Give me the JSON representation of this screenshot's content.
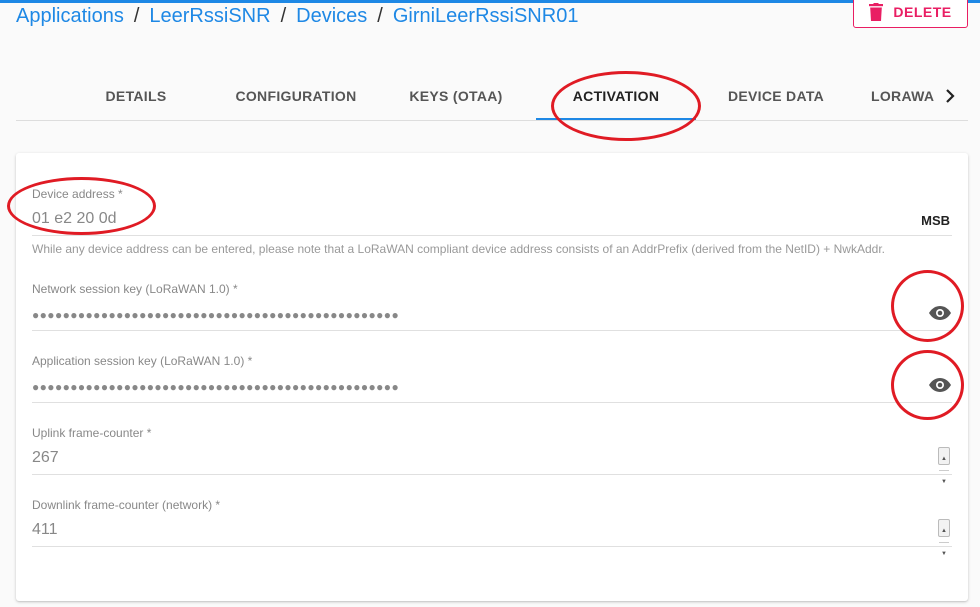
{
  "breadcrumb": [
    "Applications",
    "LeerRssiSNR",
    "Devices",
    "GirniLeerRssiSNR01"
  ],
  "breadcrumb_separator": "/",
  "delete_label": "DELETE",
  "tabs": [
    "DETAILS",
    "CONFIGURATION",
    "KEYS (OTAA)",
    "ACTIVATION",
    "DEVICE DATA",
    "LORAWA"
  ],
  "active_tab": "ACTIVATION",
  "form": {
    "device_address": {
      "label": "Device address *",
      "value": "01 e2 20 0d",
      "suffix": "MSB",
      "helper": "While any device address can be entered, please note that a LoRaWAN compliant device address consists of an AddrPrefix (derived from the NetID) + NwkAddr."
    },
    "network_session_key": {
      "label": "Network session key (LoRaWAN 1.0) *",
      "value": "●●●●●●●●●●●●●●●●●●●●●●●●●●●●●●●●●●●●●●●●●●●●●●●●"
    },
    "application_session_key": {
      "label": "Application session key (LoRaWAN 1.0) *",
      "value": "●●●●●●●●●●●●●●●●●●●●●●●●●●●●●●●●●●●●●●●●●●●●●●●●"
    },
    "uplink_frame_counter": {
      "label": "Uplink frame-counter *",
      "value": "267"
    },
    "downlink_frame_counter": {
      "label": "Downlink frame-counter (network) *",
      "value": "411"
    }
  },
  "colors": {
    "accent": "#1e88e5",
    "delete": "#e91e63",
    "annotation": "#e01b24"
  },
  "icons": {
    "delete": "trash-icon",
    "reveal": "eye-icon",
    "tabs_next": "chevron-right-icon"
  }
}
